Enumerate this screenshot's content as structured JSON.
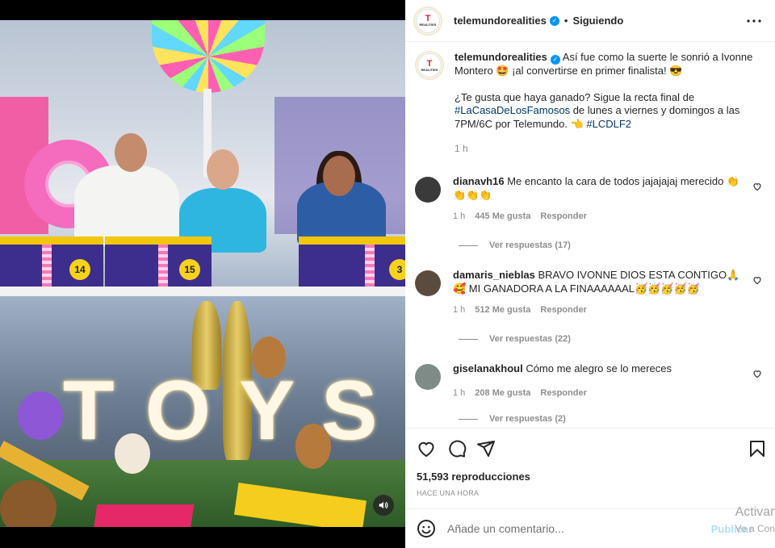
{
  "post": {
    "account": "telemundorealities",
    "avatar_text": "T",
    "avatar_subtext": "REALITIES",
    "separator": "•",
    "follow_status": "Siguiendo",
    "caption_part1": " Así fue como la suerte le sonrió a Ivonne Montero 🤩 ¡al convertirse en primer finalista! 😎",
    "caption_part2": "¿Te gusta que haya ganado? Sigue la recta final de ",
    "hashtag1": "#LaCasaDeLosFamosos",
    "caption_part3": " de lunes a viernes y domingos a las 7PM/6C por Telemundo. 👈 ",
    "hashtag2": "#LCDLF2",
    "caption_time": "1 h",
    "views": "51,593 reproducciones",
    "posted": "HACE UNA HORA"
  },
  "video": {
    "box_numbers": [
      "14",
      "15",
      "3"
    ],
    "sign_letters": [
      "T",
      "O",
      "Y",
      "S"
    ]
  },
  "comments": [
    {
      "user": "dianavh16",
      "text": " Me encanto la cara de todos jajajajaj merecido 👏👏👏👏",
      "time": "1 h",
      "likes": "445 Me gusta",
      "reply_label": "Responder",
      "view_replies": "Ver respuestas (17)",
      "avatar_color": "#3a3a3a"
    },
    {
      "user": "damaris_nieblas",
      "text": " BRAVO IVONNE DIOS ESTA CONTIGO🙏🥰 MI GANADORA A LA FINAAAAAAL🥳🥳🥳🥳🥳",
      "time": "1 h",
      "likes": "512 Me gusta",
      "reply_label": "Responder",
      "view_replies": "Ver respuestas (22)",
      "avatar_color": "#5b4a3e"
    },
    {
      "user": "giselanakhoul",
      "text": " Cómo me alegro se lo mereces",
      "time": "1 h",
      "likes": "208 Me gusta",
      "reply_label": "Responder",
      "view_replies": "Ver respuestas (2)",
      "avatar_color": "#7f8b86"
    }
  ],
  "composer": {
    "placeholder": "Añade un comentario...",
    "post_label": "Publicar"
  },
  "watermark": {
    "line1": "Activar",
    "line2": "Ve a Con"
  },
  "colors": {
    "link": "#00376b",
    "verified": "#0095f6",
    "muted": "#8e8e8e",
    "post_button": "#b2dffc"
  },
  "icons": [
    "verified-badge-icon",
    "more-options-icon",
    "heart-icon",
    "comment-icon",
    "share-icon",
    "bookmark-icon",
    "emoji-icon",
    "sound-icon"
  ]
}
